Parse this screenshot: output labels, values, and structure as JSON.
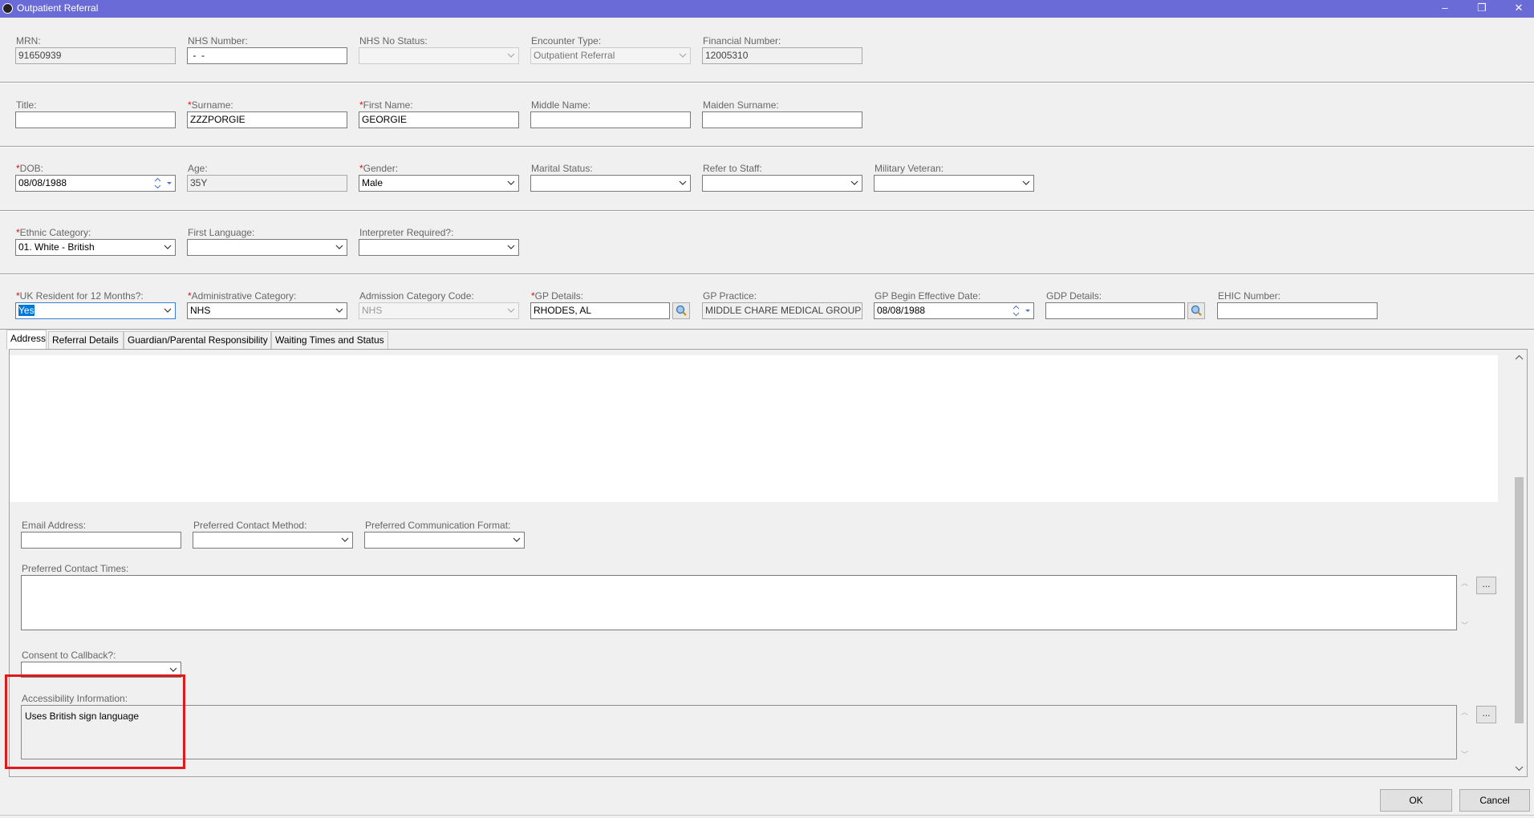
{
  "window": {
    "title": "Outpatient Referral",
    "minimize": "–",
    "restore": "❐",
    "close": "✕"
  },
  "row1": {
    "mrn_label": "MRN:",
    "mrn": "91650939",
    "nhs_number_label": "NHS Number:",
    "nhs_number": " -  -",
    "nhs_status_label": "NHS No Status:",
    "nhs_status": "",
    "encounter_type_label": "Encounter Type:",
    "encounter_type": "Outpatient Referral",
    "financial_number_label": "Financial Number:",
    "financial_number": "12005310"
  },
  "row2": {
    "title_label": "Title:",
    "title": "",
    "surname_label": "Surname:",
    "surname": "ZZZPORGIE",
    "first_name_label": "First Name:",
    "first_name": "GEORGIE",
    "middle_name_label": "Middle Name:",
    "middle_name": "",
    "maiden_surname_label": "Maiden Surname:",
    "maiden_surname": ""
  },
  "row3": {
    "dob_label": "DOB:",
    "dob": "08/08/1988",
    "age_label": "Age:",
    "age": "35Y",
    "gender_label": "Gender:",
    "gender": "Male",
    "marital_status_label": "Marital Status:",
    "marital_status": "",
    "refer_to_staff_label": "Refer to Staff:",
    "refer_to_staff": "",
    "military_veteran_label": "Military Veteran:",
    "military_veteran": ""
  },
  "row4": {
    "ethnic_category_label": "Ethnic Category:",
    "ethnic_category": "01. White - British",
    "first_language_label": "First Language:",
    "first_language": "",
    "interpreter_label": "Interpreter Required?:",
    "interpreter": ""
  },
  "row5": {
    "uk_resident_label": "UK Resident for 12 Months?:",
    "uk_resident": "Yes",
    "admin_category_label": "Administrative Category:",
    "admin_category": "NHS",
    "admission_code_label": "Admission Category Code:",
    "admission_code": "NHS",
    "gp_details_label": "GP Details:",
    "gp_details": "RHODES, AL",
    "gp_practice_label": "GP Practice:",
    "gp_practice": "MIDDLE CHARE MEDICAL GROUP",
    "gp_begin_label": "GP Begin Effective Date:",
    "gp_begin": "08/08/1988",
    "gdp_details_label": "GDP Details:",
    "gdp_details": "",
    "ehic_label": "EHIC Number:",
    "ehic": ""
  },
  "required_marker": "*",
  "tabs": [
    {
      "label": "Address"
    },
    {
      "label": "Referral Details"
    },
    {
      "label": "Guardian/Parental Responsibility"
    },
    {
      "label": "Waiting Times and Status"
    }
  ],
  "address_tab": {
    "email_label": "Email Address:",
    "email": "",
    "contact_method_label": "Preferred Contact Method:",
    "contact_method": "",
    "comm_format_label": "Preferred Communication Format:",
    "comm_format": "",
    "contact_times_label": "Preferred Contact Times:",
    "contact_times": "",
    "consent_label": "Consent to Callback?:",
    "consent": "",
    "accessibility_label": "Accessibility Information:",
    "accessibility": "Uses British sign language",
    "ellipsis": "..."
  },
  "buttons": {
    "ok": "OK",
    "cancel": "Cancel"
  },
  "colors": {
    "titlebar": "#6a6bd6",
    "highlight": "#e01a1a",
    "required": "#e01010"
  }
}
